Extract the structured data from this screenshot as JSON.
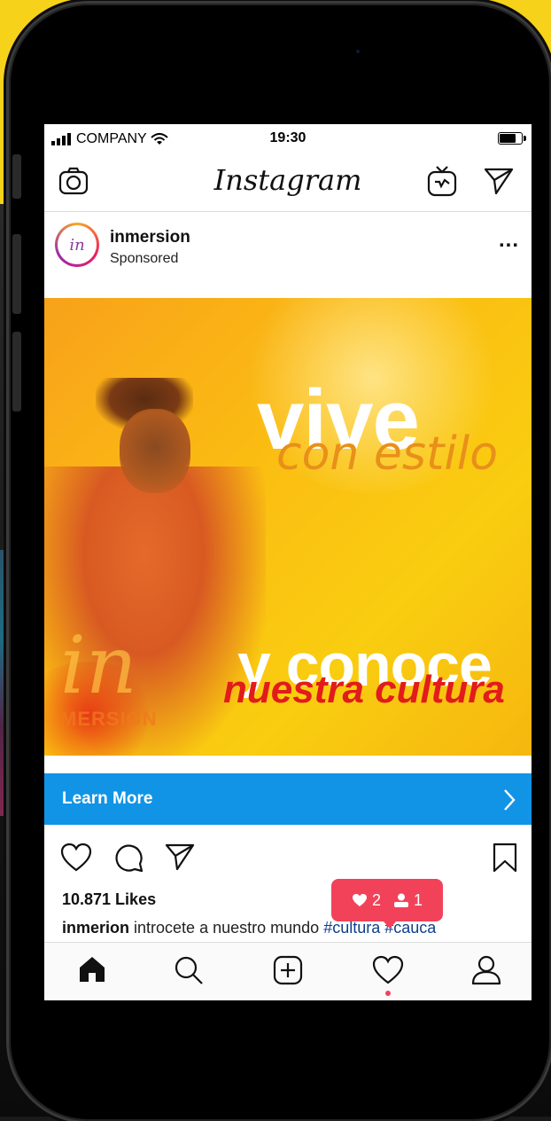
{
  "status_bar": {
    "carrier": "COMPANY",
    "time": "19:30",
    "battery_level": 0.8
  },
  "top_nav": {
    "logo": "Instagram",
    "icons": [
      "camera-icon",
      "igtv-icon",
      "direct-send-icon"
    ]
  },
  "post": {
    "username": "inmersion",
    "sponsored_label": "Sponsored",
    "avatar_text": "in",
    "more_label": "...",
    "ad": {
      "headline_big": "vive",
      "headline_script": "con estilo",
      "subline_big": "y conoce",
      "subline_script": "nuestra cultura",
      "brand_mark": "in",
      "brand_sub": "MERSIÓN"
    },
    "cta_label": "Learn More",
    "likes": "10.871 Likes",
    "caption_user": "inmerion",
    "caption_text": "introcete a nuestro mundo",
    "caption_tags": "#cultura #cauca"
  },
  "notification": {
    "likes_count": "2",
    "followers_count": "1"
  },
  "tab_bar": {
    "icons": [
      "home-icon",
      "search-icon",
      "add-post-icon",
      "activity-heart-icon",
      "profile-icon"
    ]
  },
  "colors": {
    "cta": "#1294e6",
    "notification": "#f2425a",
    "ad_background": "#fbbd12",
    "ad_script_red": "#e21b1b"
  }
}
